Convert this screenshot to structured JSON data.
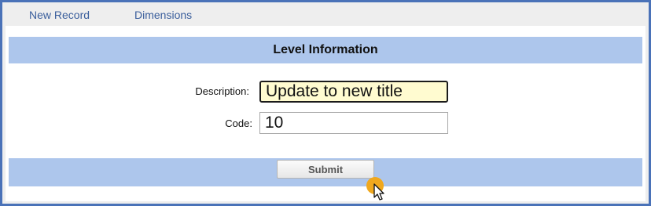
{
  "nav": {
    "new_record": "New Record",
    "dimensions": "Dimensions"
  },
  "form": {
    "title": "Level Information",
    "description_label": "Description:",
    "description_value": "Update to new title",
    "code_label": "Code:",
    "code_value": "10",
    "submit_label": "Submit"
  },
  "colors": {
    "frame_border": "#4a72b8",
    "header_bar": "#adc6ec",
    "focused_input_bg": "#fffbd0",
    "cursor_highlight": "#f0a81e"
  },
  "icons": {
    "cursor": "mouse-pointer-icon"
  }
}
